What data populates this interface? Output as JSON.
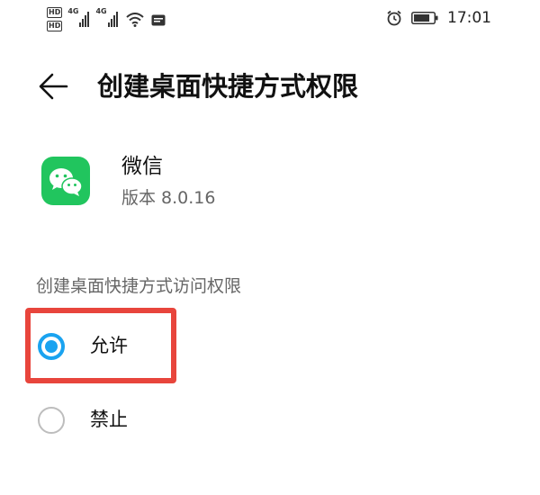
{
  "status_bar": {
    "hd1": "HD",
    "hd2": "HD",
    "net1": "4G",
    "net2": "4G",
    "time": "17:01",
    "icons": [
      "signal-icon",
      "wifi-icon",
      "message-icon",
      "alarm-icon",
      "battery-icon"
    ]
  },
  "header": {
    "title": "创建桌面快捷方式权限",
    "back_icon": "arrow-left-icon"
  },
  "app": {
    "name": "微信",
    "version": "版本 8.0.16",
    "icon": "wechat-icon",
    "icon_color": "#21c55e"
  },
  "section": {
    "label": "创建桌面快捷方式访问权限"
  },
  "options": [
    {
      "label": "允许",
      "selected": true
    },
    {
      "label": "禁止",
      "selected": false
    }
  ],
  "colors": {
    "accent": "#1aa3f0",
    "highlight": "#e8453c"
  }
}
